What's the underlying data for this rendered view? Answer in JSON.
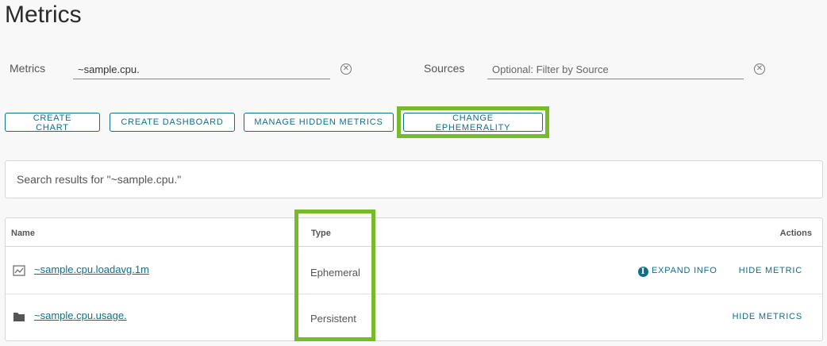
{
  "page": {
    "title": "Metrics"
  },
  "filters": {
    "metrics": {
      "label": "Metrics",
      "value": "~sample.cpu.",
      "placeholder": ""
    },
    "sources": {
      "label": "Sources",
      "value": "",
      "placeholder": "Optional: Filter by Source"
    },
    "clear_icon": "circle-x-icon"
  },
  "toolbar": {
    "create_chart": "CREATE CHART",
    "create_dashboard": "CREATE DASHBOARD",
    "manage_hidden": "MANAGE HIDDEN METRICS",
    "change_ephemerality": "CHANGE EPHEMERALITY"
  },
  "search": {
    "results_text": "Search results for \"~sample.cpu.\""
  },
  "table": {
    "headers": {
      "name": "Name",
      "type": "Type",
      "actions": "Actions"
    },
    "rows": [
      {
        "icon": "line-chart-icon",
        "name": "~sample.cpu.loadavg.1m",
        "type": "Ephemeral",
        "expand": "EXPAND INFO",
        "action": "HIDE METRIC"
      },
      {
        "icon": "folder-icon",
        "name": "~sample.cpu.usage.",
        "type": "Persistent",
        "action": "HIDE METRICS"
      }
    ]
  },
  "colors": {
    "accent": "#0f6f8a",
    "highlight": "#77bb2a"
  }
}
